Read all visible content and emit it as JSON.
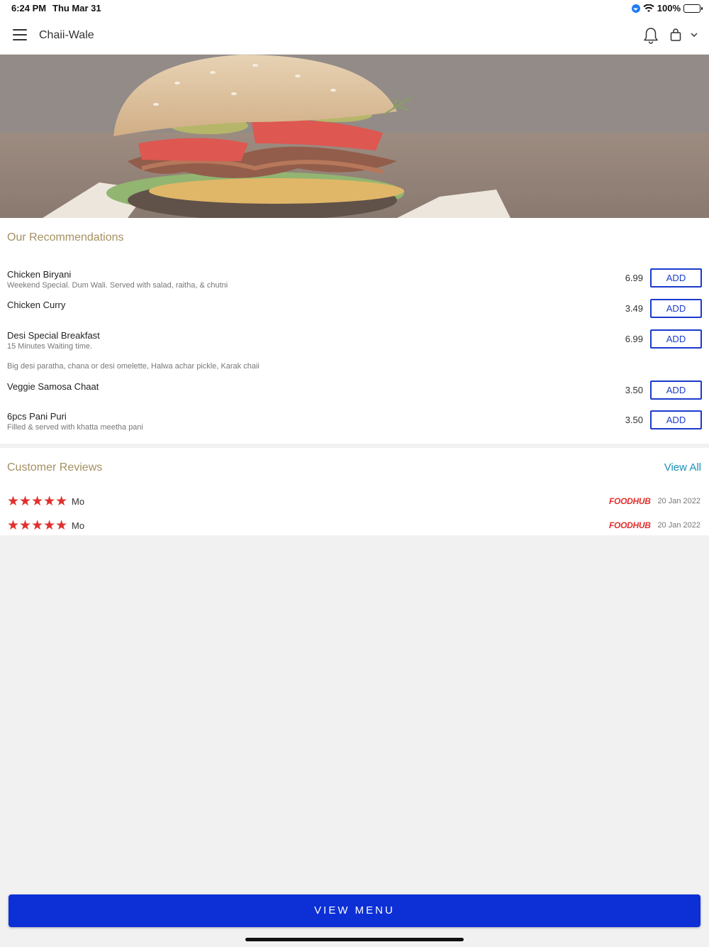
{
  "status_bar": {
    "time": "6:24 PM",
    "date": "Thu Mar 31",
    "battery": "100%"
  },
  "header": {
    "title": "Chaii-Wale"
  },
  "recommendations": {
    "title": "Our Recommendations",
    "items": [
      {
        "name": "Chicken Biryani",
        "desc": "Weekend Special. Dum Wali. Served with salad, raitha, & chutni",
        "price": "6.99",
        "button": "ADD"
      },
      {
        "name": "Chicken Curry",
        "desc": "",
        "price": "3.49",
        "button": "ADD"
      },
      {
        "name": "Desi Special Breakfast",
        "desc": "15 Minutes Waiting time.",
        "extra": "Big desi paratha, chana or desi omelette, Halwa achar pickle, Karak chaii",
        "price": "6.99",
        "button": "ADD"
      },
      {
        "name": "Veggie Samosa Chaat",
        "desc": "",
        "price": "3.50",
        "button": "ADD"
      },
      {
        "name": "6pcs Pani Puri",
        "desc": "Filled & served with khatta meetha pani",
        "price": "3.50",
        "button": "ADD"
      }
    ]
  },
  "reviews": {
    "title": "Customer Reviews",
    "view_all": "View All",
    "items": [
      {
        "rating": 5,
        "stars": "★★★★★",
        "name": "Mo",
        "source": "FOODHUB",
        "date": "20 Jan 2022"
      },
      {
        "rating": 5,
        "stars": "★★★★★",
        "name": "Mo",
        "source": "FOODHUB",
        "date": "20 Jan 2022"
      }
    ]
  },
  "footer": {
    "button": "VIEW MENU"
  },
  "colors": {
    "accent": "#0c2fd6",
    "section_title": "#a59062",
    "star": "#e0302d",
    "link": "#1a8fb8"
  }
}
